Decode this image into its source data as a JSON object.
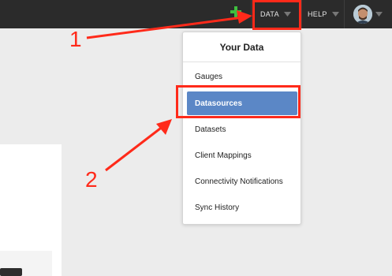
{
  "topbar": {
    "data_label": "DATA",
    "help_label": "HELP"
  },
  "dropdown": {
    "title": "Your Data",
    "items": [
      {
        "label": "Gauges"
      },
      {
        "label": "Datasources"
      },
      {
        "label": "Datasets"
      },
      {
        "label": "Client Mappings"
      },
      {
        "label": "Connectivity Notifications"
      },
      {
        "label": "Sync History"
      }
    ]
  },
  "annotations": {
    "step1": "1",
    "step2": "2"
  },
  "colors": {
    "topbar": "#2b2b2b",
    "accent": "#5b87c6",
    "annotation": "#ff2a1a",
    "plus": "#3fbf3f"
  },
  "icons": [
    "plus-icon",
    "chevron-down-icon",
    "avatar"
  ]
}
